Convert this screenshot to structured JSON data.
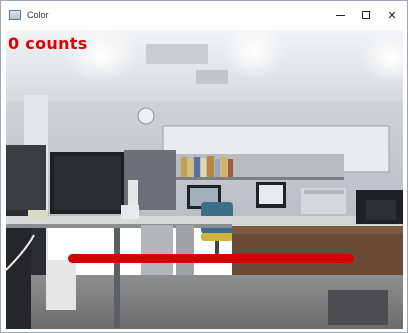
{
  "window": {
    "title": "Color"
  },
  "overlay": {
    "count_text": "0 counts",
    "bar_color": "#d30000",
    "text_color": "#e00000"
  },
  "scene": {
    "description_icon": "office-camera-view"
  }
}
